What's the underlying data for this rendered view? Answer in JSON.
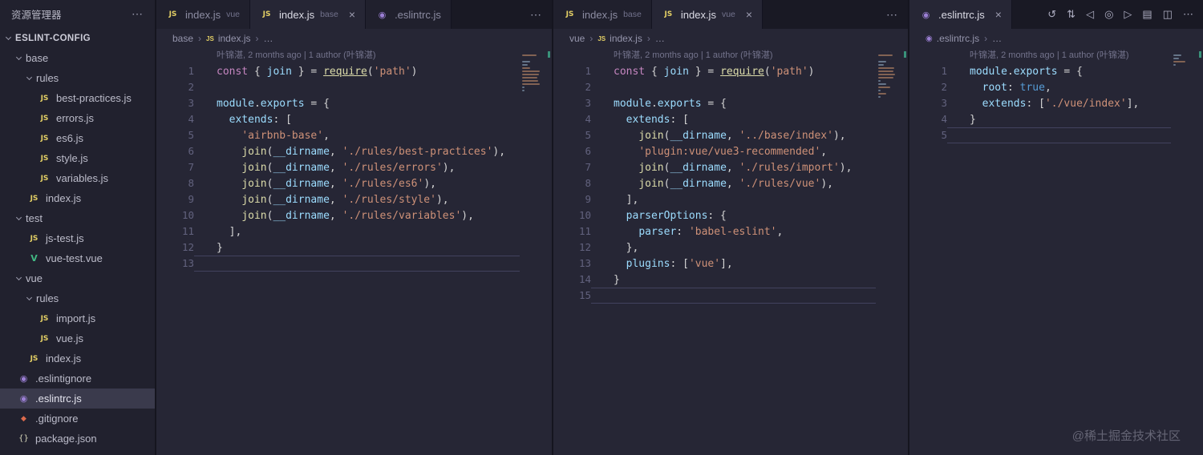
{
  "icons": {
    "js": "JS",
    "vue": "V",
    "eslint": "◉",
    "git": "◆",
    "json": "{}"
  },
  "sidebar": {
    "title": "资源管理器",
    "more_icon": "⋯",
    "project": "ESLINT-CONFIG",
    "tree": [
      {
        "label": "base",
        "type": "folder",
        "indent": 1
      },
      {
        "label": "rules",
        "type": "folder",
        "indent": 2
      },
      {
        "label": "best-practices.js",
        "type": "js",
        "indent": 3
      },
      {
        "label": "errors.js",
        "type": "js",
        "indent": 3
      },
      {
        "label": "es6.js",
        "type": "js",
        "indent": 3
      },
      {
        "label": "style.js",
        "type": "js",
        "indent": 3
      },
      {
        "label": "variables.js",
        "type": "js",
        "indent": 3
      },
      {
        "label": "index.js",
        "type": "js",
        "indent": 2
      },
      {
        "label": "test",
        "type": "folder",
        "indent": 1
      },
      {
        "label": "js-test.js",
        "type": "js",
        "indent": 2
      },
      {
        "label": "vue-test.vue",
        "type": "vue",
        "indent": 2
      },
      {
        "label": "vue",
        "type": "folder",
        "indent": 1
      },
      {
        "label": "rules",
        "type": "folder",
        "indent": 2
      },
      {
        "label": "import.js",
        "type": "js",
        "indent": 3
      },
      {
        "label": "vue.js",
        "type": "js",
        "indent": 3
      },
      {
        "label": "index.js",
        "type": "js",
        "indent": 2
      },
      {
        "label": ".eslintignore",
        "type": "eslint",
        "indent": 1
      },
      {
        "label": ".eslintrc.js",
        "type": "eslint",
        "indent": 1,
        "selected": true
      },
      {
        "label": ".gitignore",
        "type": "git",
        "indent": 1
      },
      {
        "label": "package.json",
        "type": "json",
        "indent": 1
      }
    ]
  },
  "groups": [
    {
      "tabs": [
        {
          "icon": "js",
          "name": "index.js",
          "hint": "vue",
          "active": false,
          "close": false
        },
        {
          "icon": "js",
          "name": "index.js",
          "hint": "base",
          "active": true,
          "close": true
        },
        {
          "icon": "eslint",
          "name": ".eslintrc.js",
          "hint": "",
          "active": false,
          "close": false
        }
      ],
      "more": "⋯",
      "breadcrumb": [
        {
          "label": "base"
        },
        {
          "icon": "js",
          "label": "index.js"
        },
        {
          "label": "…"
        }
      ],
      "codelens": "叶锦湛, 2 months ago | 1 author (叶锦湛)",
      "current_line": 13,
      "lines": [
        [
          [
            "kw",
            "const"
          ],
          [
            "pl",
            " { "
          ],
          [
            "var",
            "join"
          ],
          [
            "pl",
            " } = "
          ],
          [
            "fn u",
            "require"
          ],
          [
            "pl",
            "("
          ],
          [
            "str",
            "'path'"
          ],
          [
            "pl",
            ")"
          ]
        ],
        [],
        [
          [
            "var",
            "module"
          ],
          [
            "pl",
            "."
          ],
          [
            "var",
            "exports"
          ],
          [
            "pl",
            " = {"
          ]
        ],
        [
          [
            "pl",
            "  "
          ],
          [
            "var",
            "extends"
          ],
          [
            "pl",
            ": ["
          ]
        ],
        [
          [
            "pl",
            "    "
          ],
          [
            "str",
            "'airbnb-base'"
          ],
          [
            "pl",
            ","
          ]
        ],
        [
          [
            "pl",
            "    "
          ],
          [
            "fn",
            "join"
          ],
          [
            "pl",
            "("
          ],
          [
            "var",
            "__dirname"
          ],
          [
            "pl",
            ", "
          ],
          [
            "str",
            "'./rules/best-practices'"
          ],
          [
            "pl",
            "),"
          ]
        ],
        [
          [
            "pl",
            "    "
          ],
          [
            "fn",
            "join"
          ],
          [
            "pl",
            "("
          ],
          [
            "var",
            "__dirname"
          ],
          [
            "pl",
            ", "
          ],
          [
            "str",
            "'./rules/errors'"
          ],
          [
            "pl",
            "),"
          ]
        ],
        [
          [
            "pl",
            "    "
          ],
          [
            "fn",
            "join"
          ],
          [
            "pl",
            "("
          ],
          [
            "var",
            "__dirname"
          ],
          [
            "pl",
            ", "
          ],
          [
            "str",
            "'./rules/es6'"
          ],
          [
            "pl",
            "),"
          ]
        ],
        [
          [
            "pl",
            "    "
          ],
          [
            "fn",
            "join"
          ],
          [
            "pl",
            "("
          ],
          [
            "var",
            "__dirname"
          ],
          [
            "pl",
            ", "
          ],
          [
            "str",
            "'./rules/style'"
          ],
          [
            "pl",
            "),"
          ]
        ],
        [
          [
            "pl",
            "    "
          ],
          [
            "fn",
            "join"
          ],
          [
            "pl",
            "("
          ],
          [
            "var",
            "__dirname"
          ],
          [
            "pl",
            ", "
          ],
          [
            "str",
            "'./rules/variables'"
          ],
          [
            "pl",
            "),"
          ]
        ],
        [
          [
            "pl",
            "  ],"
          ]
        ],
        [
          [
            "pl",
            "}"
          ]
        ],
        []
      ]
    },
    {
      "tabs": [
        {
          "icon": "js",
          "name": "index.js",
          "hint": "base",
          "active": false,
          "close": false
        },
        {
          "icon": "js",
          "name": "index.js",
          "hint": "vue",
          "active": true,
          "close": true
        }
      ],
      "more": "⋯",
      "breadcrumb": [
        {
          "label": "vue"
        },
        {
          "icon": "js",
          "label": "index.js"
        },
        {
          "label": "…"
        }
      ],
      "codelens": "叶锦湛, 2 months ago | 1 author (叶锦湛)",
      "current_line": 15,
      "lines": [
        [
          [
            "kw",
            "const"
          ],
          [
            "pl",
            " { "
          ],
          [
            "var",
            "join"
          ],
          [
            "pl",
            " } = "
          ],
          [
            "fn u",
            "require"
          ],
          [
            "pl",
            "("
          ],
          [
            "str",
            "'path'"
          ],
          [
            "pl",
            ")"
          ]
        ],
        [],
        [
          [
            "var",
            "module"
          ],
          [
            "pl",
            "."
          ],
          [
            "var",
            "exports"
          ],
          [
            "pl",
            " = {"
          ]
        ],
        [
          [
            "pl",
            "  "
          ],
          [
            "var",
            "extends"
          ],
          [
            "pl",
            ": ["
          ]
        ],
        [
          [
            "pl",
            "    "
          ],
          [
            "fn",
            "join"
          ],
          [
            "pl",
            "("
          ],
          [
            "var",
            "__dirname"
          ],
          [
            "pl",
            ", "
          ],
          [
            "str",
            "'../base/index'"
          ],
          [
            "pl",
            "),"
          ]
        ],
        [
          [
            "pl",
            "    "
          ],
          [
            "str",
            "'plugin:vue/vue3-recommended'"
          ],
          [
            "pl",
            ","
          ]
        ],
        [
          [
            "pl",
            "    "
          ],
          [
            "fn",
            "join"
          ],
          [
            "pl",
            "("
          ],
          [
            "var",
            "__dirname"
          ],
          [
            "pl",
            ", "
          ],
          [
            "str",
            "'./rules/import'"
          ],
          [
            "pl",
            "),"
          ]
        ],
        [
          [
            "pl",
            "    "
          ],
          [
            "fn",
            "join"
          ],
          [
            "pl",
            "("
          ],
          [
            "var",
            "__dirname"
          ],
          [
            "pl",
            ", "
          ],
          [
            "str",
            "'./rules/vue'"
          ],
          [
            "pl",
            "),"
          ]
        ],
        [
          [
            "pl",
            "  ],"
          ]
        ],
        [
          [
            "pl",
            "  "
          ],
          [
            "var",
            "parserOptions"
          ],
          [
            "pl",
            ": {"
          ]
        ],
        [
          [
            "pl",
            "    "
          ],
          [
            "var",
            "parser"
          ],
          [
            "pl",
            ": "
          ],
          [
            "str",
            "'babel-eslint'"
          ],
          [
            "pl",
            ","
          ]
        ],
        [
          [
            "pl",
            "  },"
          ]
        ],
        [
          [
            "pl",
            "  "
          ],
          [
            "var",
            "plugins"
          ],
          [
            "pl",
            ": ["
          ],
          [
            "str",
            "'vue'"
          ],
          [
            "pl",
            "],"
          ]
        ],
        [
          [
            "pl",
            "}"
          ]
        ],
        []
      ]
    },
    {
      "tabs": [
        {
          "icon": "eslint",
          "name": ".eslintrc.js",
          "hint": "",
          "active": true,
          "close": true
        }
      ],
      "more": null,
      "actions": [
        {
          "name": "timeline-history-icon",
          "glyph": "↺"
        },
        {
          "name": "compare-changes-icon",
          "glyph": "⇅"
        },
        {
          "name": "previous-revision-icon",
          "glyph": "◁"
        },
        {
          "name": "open-changes-icon",
          "glyph": "◎"
        },
        {
          "name": "next-revision-icon",
          "glyph": "▷"
        },
        {
          "name": "file-annotations-icon",
          "glyph": "▤"
        },
        {
          "name": "split-editor-icon",
          "glyph": "◫"
        },
        {
          "name": "more-actions-icon",
          "glyph": "⋯"
        }
      ],
      "breadcrumb": [
        {
          "icon": "eslint",
          "label": ".eslintrc.js"
        },
        {
          "label": "…"
        }
      ],
      "codelens": "叶锦湛, 2 months ago | 1 author (叶锦湛)",
      "current_line": 5,
      "lines": [
        [
          [
            "var",
            "module"
          ],
          [
            "pl",
            "."
          ],
          [
            "var",
            "exports"
          ],
          [
            "pl",
            " = {"
          ]
        ],
        [
          [
            "pl",
            "  "
          ],
          [
            "var",
            "root"
          ],
          [
            "pl",
            ": "
          ],
          [
            "bool",
            "true"
          ],
          [
            "pl",
            ","
          ]
        ],
        [
          [
            "pl",
            "  "
          ],
          [
            "var",
            "extends"
          ],
          [
            "pl",
            ": ["
          ],
          [
            "str",
            "'./vue/index'"
          ],
          [
            "pl",
            "],"
          ]
        ],
        [
          [
            "pl",
            "}"
          ]
        ],
        []
      ]
    }
  ],
  "watermark": "@稀土掘金技术社区"
}
